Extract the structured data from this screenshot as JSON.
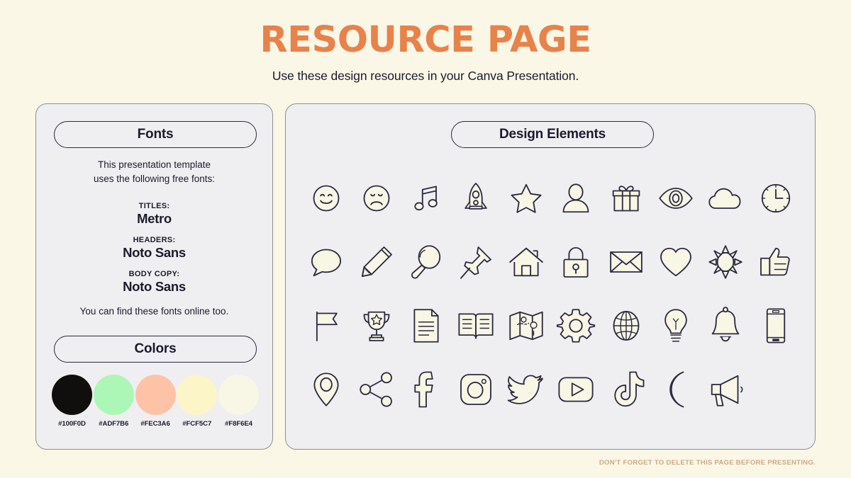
{
  "header": {
    "title": "RESOURCE PAGE",
    "subtitle": "Use these design resources in your Canva Presentation.",
    "title_color": "#E8824B"
  },
  "fonts_panel": {
    "pill_label": "Fonts",
    "intro_line1": "This presentation template",
    "intro_line2": "uses the following free fonts:",
    "groups": [
      {
        "role": "TITLES:",
        "name": "Metro"
      },
      {
        "role": "HEADERS:",
        "name": "Noto Sans"
      },
      {
        "role": "BODY COPY:",
        "name": "Noto Sans"
      }
    ],
    "outro": "You can find these fonts online too."
  },
  "colors_panel": {
    "pill_label": "Colors",
    "swatches": [
      {
        "hex": "#100F0D",
        "label": "#100F0D"
      },
      {
        "hex": "#ADF7B6",
        "label": "#ADF7B6"
      },
      {
        "hex": "#FEC3A6",
        "label": "#FEC3A6"
      },
      {
        "hex": "#FCF5C7",
        "label": "#FCF5C7"
      },
      {
        "hex": "#F8F6E4",
        "label": "#F8F6E4"
      }
    ]
  },
  "elements_panel": {
    "pill_label": "Design Elements",
    "icon_fill": "#F8F6E4",
    "icon_stroke": "#2B2A42",
    "icons": [
      "smiley-face-icon",
      "sad-face-icon",
      "music-note-icon",
      "rocket-icon",
      "star-icon",
      "person-icon",
      "gift-icon",
      "eye-icon",
      "cloud-icon",
      "clock-icon",
      "speech-bubble-icon",
      "pencil-icon",
      "magnifying-glass-icon",
      "pushpin-icon",
      "house-icon",
      "lock-icon",
      "envelope-icon",
      "heart-icon",
      "sun-icon",
      "thumbs-up-icon",
      "flag-icon",
      "trophy-icon",
      "document-icon",
      "open-book-icon",
      "map-icon",
      "gear-icon",
      "globe-icon",
      "lightbulb-icon",
      "bell-icon",
      "mobile-phone-icon",
      "location-pin-icon",
      "share-icon",
      "facebook-icon",
      "instagram-icon",
      "twitter-icon",
      "youtube-icon",
      "tiktok-icon",
      "moon-icon",
      "megaphone-icon"
    ]
  },
  "footer": {
    "note": "DON'T FORGET TO DELETE THIS PAGE BEFORE PRESENTING."
  }
}
